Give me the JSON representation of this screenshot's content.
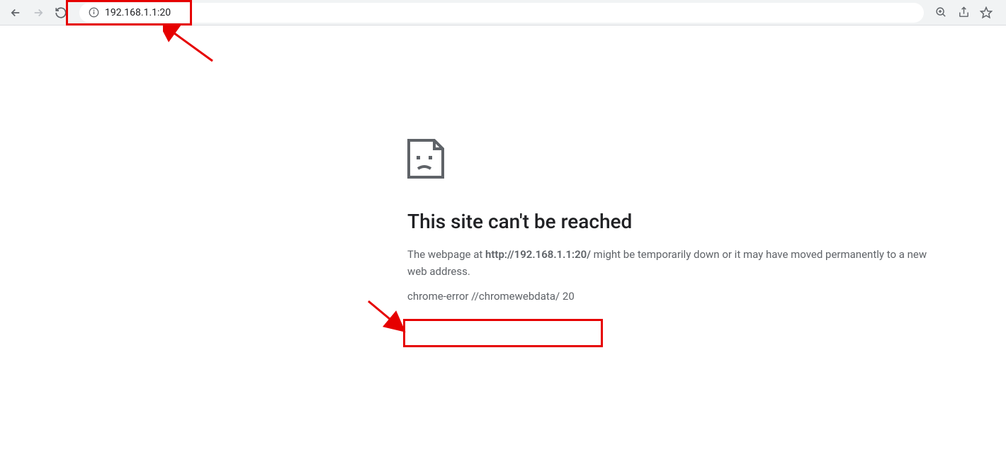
{
  "toolbar": {
    "url": "192.168.1.1:20"
  },
  "error": {
    "title": "This site can't be reached",
    "desc_pre": "The webpage at ",
    "desc_url": "http://192.168.1.1:20/",
    "desc_post": " might be temporarily down or it may have moved permanently to a new web address.",
    "code": "chrome-error //chromewebdata/ 20"
  }
}
